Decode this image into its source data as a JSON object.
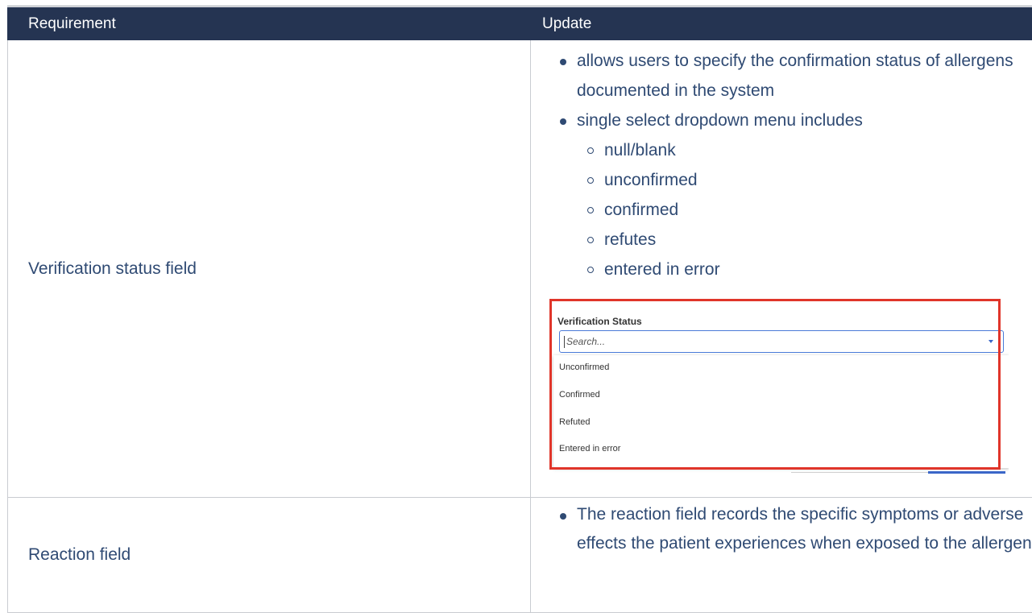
{
  "table": {
    "headers": {
      "requirement": "Requirement",
      "update": "Update"
    },
    "rows": [
      {
        "requirement": "Verification status field",
        "bullets": [
          "allows users to specify the confirmation status of allergens documented in the system",
          "single select dropdown menu includes"
        ],
        "sub_bullets": [
          "null/blank",
          "unconfirmed",
          "confirmed",
          "refutes",
          "entered in error"
        ],
        "screenshot": {
          "label": "Verification Status",
          "placeholder": "Search...",
          "options": [
            "Unconfirmed",
            "Confirmed",
            "Refuted",
            "Entered in error"
          ]
        }
      },
      {
        "requirement": "Reaction field",
        "bullets": [
          "The reaction field records the specific symptoms or adverse effects the patient experiences when exposed to the allergen"
        ]
      }
    ]
  },
  "colors": {
    "header_bg": "#253452",
    "body_text": "#2f4a73",
    "highlight_border": "#e0352a"
  }
}
